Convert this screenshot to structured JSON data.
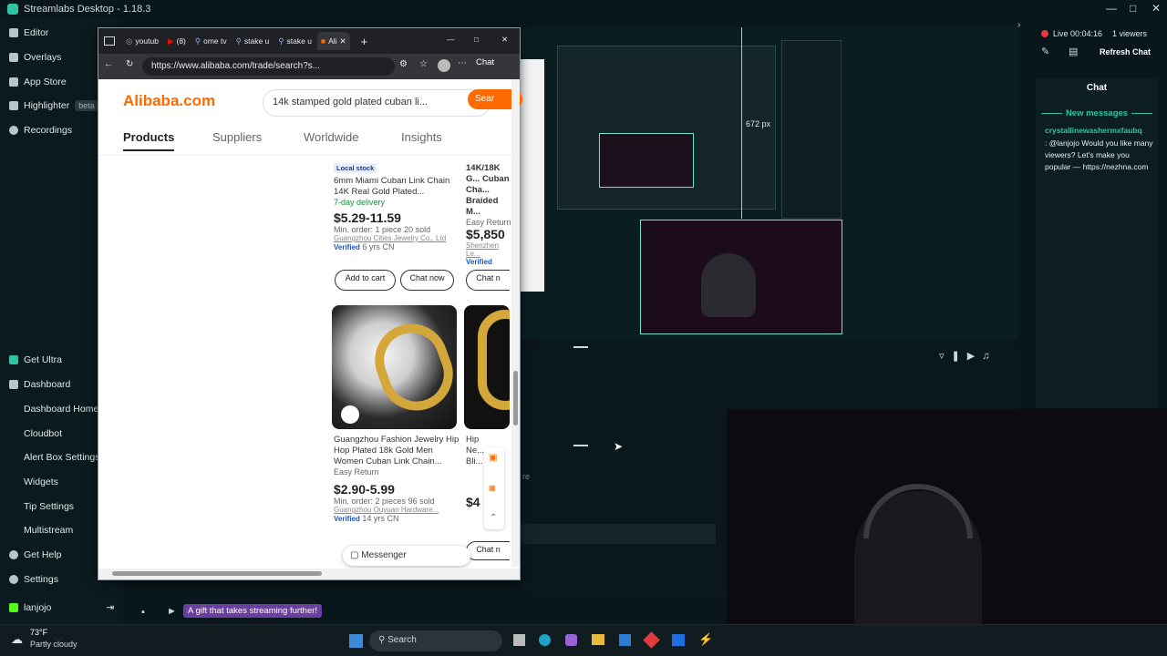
{
  "app": {
    "title": "Streamlabs Desktop - 1.18.3"
  },
  "sidebar": {
    "top_items": [
      {
        "label": "Editor",
        "icon": "editor-icon"
      },
      {
        "label": "Overlays",
        "icon": "overlays-icon"
      },
      {
        "label": "App Store",
        "icon": "store-icon"
      },
      {
        "label": "Highlighter",
        "icon": "highlighter-icon",
        "badge": "beta"
      },
      {
        "label": "Recordings",
        "icon": "recordings-icon"
      }
    ],
    "bottom_items": {
      "get_ultra": "Get Ultra",
      "dashboard": "Dashboard",
      "dashboard_home": "Dashboard Home",
      "cloudbot": "Cloudbot",
      "alert_box": "Alert Box Settings",
      "widgets": "Widgets",
      "tip_settings": "Tip Settings",
      "multistream": "Multistream",
      "get_help": "Get Help",
      "settings": "Settings",
      "user": "lanjojo"
    }
  },
  "browser": {
    "tabs": [
      {
        "label": "youtub"
      },
      {
        "label": "(8)"
      },
      {
        "label": "ome tv"
      },
      {
        "label": "stake u"
      },
      {
        "label": "stake u"
      },
      {
        "label": "Ali"
      }
    ],
    "url": "https://www.alibaba.com/trade/search?s...",
    "chat_label": "Chat",
    "site": {
      "logo": "Alibaba.com",
      "search_value": "14k stamped gold plated cuban li...",
      "search_button": "Sear",
      "nav_tabs": [
        "Products",
        "Suppliers",
        "Worldwide",
        "Insights"
      ],
      "products": [
        {
          "badge": "Local stock",
          "title": "6mm Miami Cuban Link Chain 14K Real Gold Plated...",
          "delivery": "7-day delivery",
          "price": "$5.29-11.59",
          "min_order": "Min. order: 1 piece",
          "sold": "20 sold",
          "supplier": "Guangzhou Cities Jewelry Co., Ltd",
          "verified": "Verified",
          "years": "6 yrs",
          "country": "CN",
          "add_to_cart": "Add to cart",
          "chat_now": "Chat now"
        },
        {
          "title": "14K/18K G... Cuban Cha... Braided M...",
          "badge": "Easy Return",
          "price": "$5,850",
          "supplier": "Shenzhen Le...",
          "verified": "Verified",
          "chat_now": "Chat n"
        },
        {
          "title": "Guangzhou Fashion Jewelry Hip Hop Plated 18k Gold Men Women Cuban Link Chain...",
          "badge": "Easy Return",
          "price": "$2.90-5.99",
          "min_order": "Min. order: 2 pieces",
          "sold": "96 sold",
          "supplier": "Guangzhou Ouyuan Hardware...",
          "verified": "Verified",
          "years": "14 yrs",
          "country": "CN"
        },
        {
          "title": "Hip Ne... Bli...",
          "price": "$4",
          "chat_now": "Chat n"
        }
      ],
      "messenger": "Messenger"
    }
  },
  "preview": {
    "measure_label": "672 px"
  },
  "chat": {
    "status": "Live 00:04:16",
    "viewers": "1 viewers",
    "refresh": "Refresh Chat",
    "header": "Chat",
    "new_messages": "New messages",
    "username": "crystallinewashermxfaubq",
    "message": ": @lanjojo Would you like many viewers? Let's make you popular — https://nezhna.com"
  },
  "statusbar": {
    "promo": "A gift that takes streaming further!"
  },
  "taskbar": {
    "weather_temp": "73°F",
    "weather_desc": "Partly cloudy",
    "search": "Search"
  },
  "colors": {
    "accent": "#31c3a2",
    "alibaba_orange": "#ff6a00",
    "live_red": "#e63946",
    "promo_purple": "#6b3fa0"
  }
}
